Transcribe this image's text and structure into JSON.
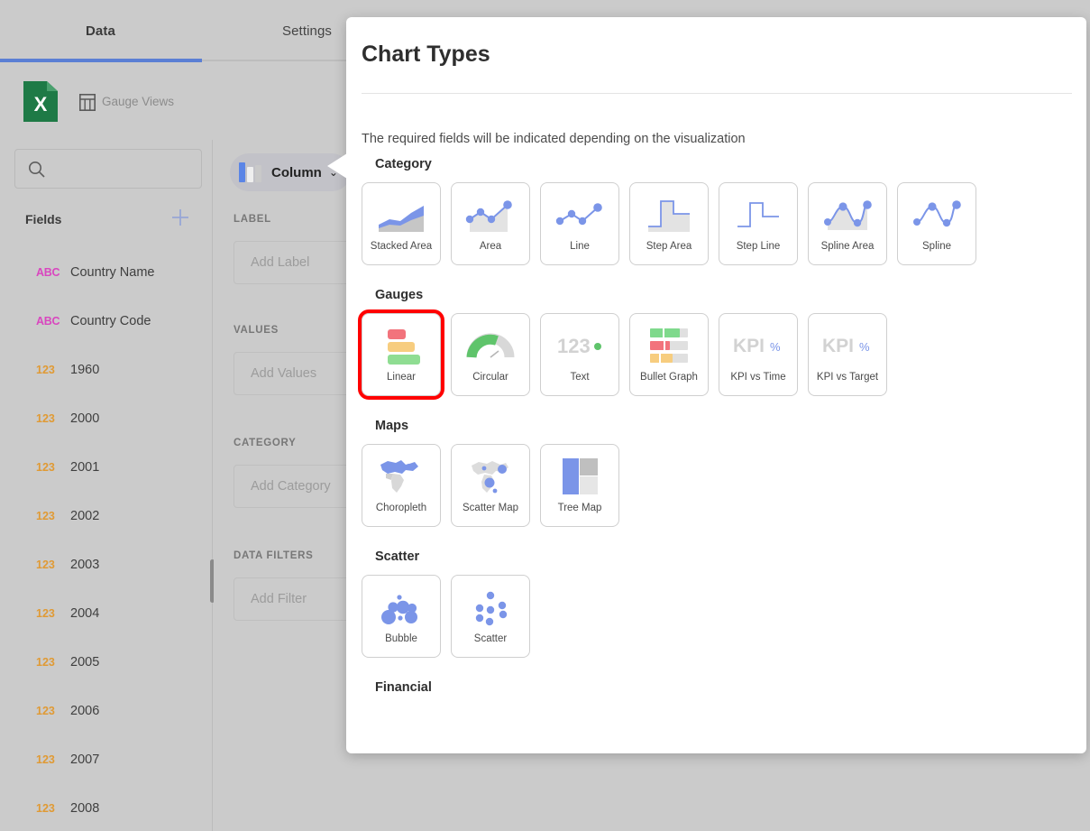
{
  "app": {
    "tabs": [
      {
        "label": "Data",
        "active": true
      },
      {
        "label": "Settings",
        "active": false
      }
    ],
    "source": {
      "file_icon": "excel-file-icon",
      "view_icon": "table-icon",
      "view_name": "Gauge Views"
    },
    "left_panel": {
      "search_placeholder": "",
      "search_value": "",
      "search_icon": "search-icon",
      "fields_title": "Fields",
      "add_field_icon": "plus-icon",
      "fields": [
        {
          "type": "ABC",
          "name": "Country Name"
        },
        {
          "type": "ABC",
          "name": "Country Code"
        },
        {
          "type": "123",
          "name": "1960"
        },
        {
          "type": "123",
          "name": "2000"
        },
        {
          "type": "123",
          "name": "2001"
        },
        {
          "type": "123",
          "name": "2002"
        },
        {
          "type": "123",
          "name": "2003"
        },
        {
          "type": "123",
          "name": "2004"
        },
        {
          "type": "123",
          "name": "2005"
        },
        {
          "type": "123",
          "name": "2006"
        },
        {
          "type": "123",
          "name": "2007"
        },
        {
          "type": "123",
          "name": "2008"
        }
      ]
    },
    "config_panel": {
      "chart_chip": {
        "label": "Column",
        "caret_icon": "chevron-down-icon"
      },
      "sections": [
        {
          "title": "LABEL",
          "placeholder": "Add Label"
        },
        {
          "title": "VALUES",
          "placeholder": "Add Values"
        },
        {
          "title": "CATEGORY",
          "placeholder": "Add Category"
        },
        {
          "title": "DATA FILTERS",
          "placeholder": "Add Filter"
        }
      ]
    }
  },
  "modal": {
    "title": "Chart Types",
    "subtitle": "The required fields will be indicated depending on the visualization",
    "selected_tile": "Linear",
    "selection_color": "#ff0000",
    "groups": [
      {
        "name": "Category",
        "tiles": [
          {
            "label": "Stacked Area",
            "art": "stacked-area"
          },
          {
            "label": "Area",
            "art": "area"
          },
          {
            "label": "Line",
            "art": "line"
          },
          {
            "label": "Step Area",
            "art": "step-area"
          },
          {
            "label": "Step Line",
            "art": "step-line"
          },
          {
            "label": "Spline Area",
            "art": "spline-area"
          },
          {
            "label": "Spline",
            "art": "spline"
          }
        ]
      },
      {
        "name": "Gauges",
        "tiles": [
          {
            "label": "Linear",
            "art": "linear-gauge",
            "selected": true
          },
          {
            "label": "Circular",
            "art": "circular-gauge"
          },
          {
            "label": "Text",
            "art": "text-gauge"
          },
          {
            "label": "Bullet Graph",
            "art": "bullet-graph"
          },
          {
            "label": "KPI vs Time",
            "art": "kpi"
          },
          {
            "label": "KPI vs Target",
            "art": "kpi"
          }
        ]
      },
      {
        "name": "Maps",
        "tiles": [
          {
            "label": "Choropleth",
            "art": "choropleth"
          },
          {
            "label": "Scatter Map",
            "art": "scatter-map"
          },
          {
            "label": "Tree Map",
            "art": "tree-map"
          }
        ]
      },
      {
        "name": "Scatter",
        "tiles": [
          {
            "label": "Bubble",
            "art": "bubble"
          },
          {
            "label": "Scatter",
            "art": "scatter"
          }
        ]
      },
      {
        "name": "Financial",
        "tiles": []
      }
    ]
  },
  "colors": {
    "accent_blue": "#7b95e8",
    "tab_underline": "#5b7fd4",
    "gauge_red": "#f2737c",
    "gauge_yellow": "#f7cd7f",
    "gauge_green": "#8fdd92",
    "excel_green": "#1e7a46",
    "field_text_type": "#d946bf",
    "field_num_type": "#e09a34",
    "panel_bg": "#cbcbcb",
    "modal_bg": "#ffffff"
  }
}
